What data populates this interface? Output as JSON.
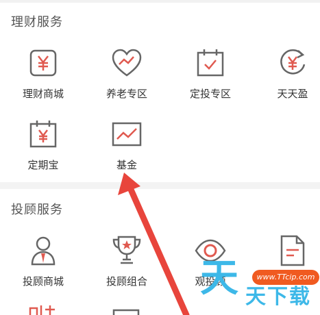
{
  "sections": {
    "wealth": {
      "title": "理财服务",
      "items": [
        {
          "label": "理财商城",
          "icon": "yen-box-icon"
        },
        {
          "label": "养老专区",
          "icon": "heart-chart-icon"
        },
        {
          "label": "定投专区",
          "icon": "calendar-check-icon"
        },
        {
          "label": "天天盈",
          "icon": "yen-refresh-icon"
        },
        {
          "label": "定期宝",
          "icon": "calendar-yen-icon"
        },
        {
          "label": "基金",
          "icon": "line-chart-icon"
        }
      ]
    },
    "advisory": {
      "title": "投顾服务",
      "items": [
        {
          "label": "投顾商城",
          "icon": "advisor-person-icon"
        },
        {
          "label": "投顾组合",
          "icon": "trophy-icon"
        },
        {
          "label": "观投顾",
          "icon": "eye-icon"
        },
        {
          "label": "",
          "icon": "document-icon"
        }
      ]
    }
  },
  "watermark": {
    "url": "www.TTcip.com",
    "big": "天",
    "small": "天下载"
  },
  "colors": {
    "accent": "#e05a50",
    "icon_outline": "#666666",
    "arrow": "#e8453c",
    "watermark_blue": "#3db8e8",
    "watermark_orange": "#f05a20"
  }
}
